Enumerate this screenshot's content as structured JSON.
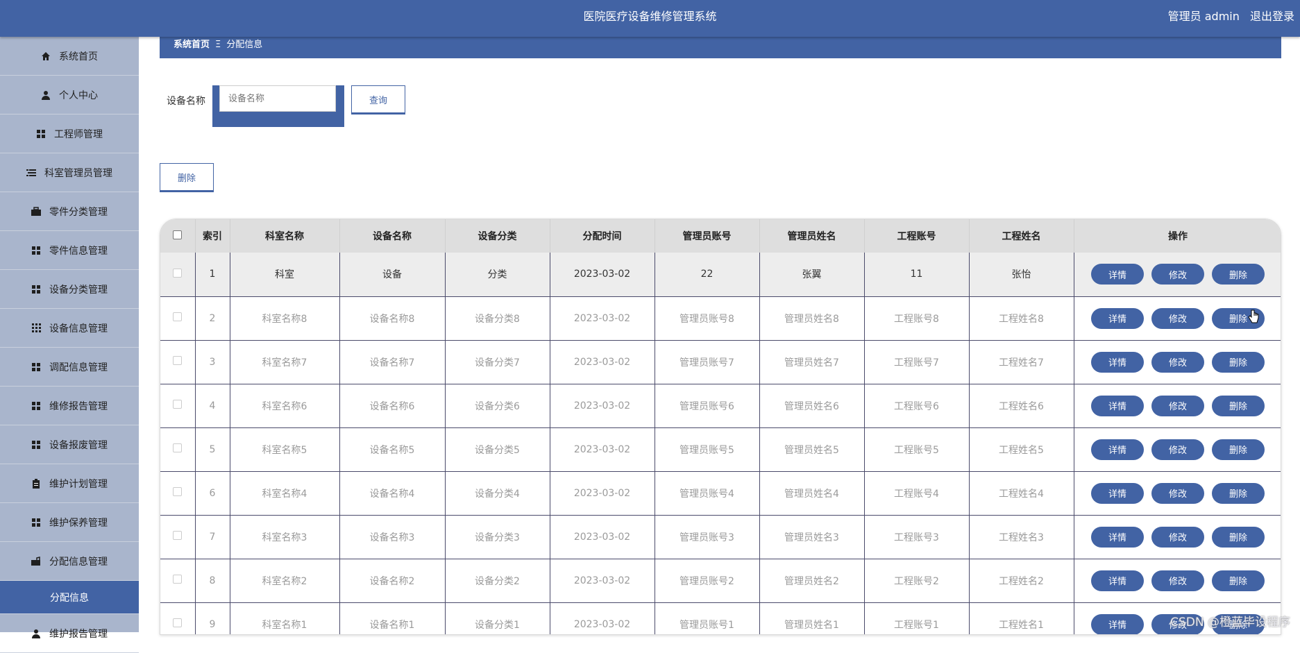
{
  "app": {
    "title": "医院医疗设备维修管理系统",
    "user": "管理员 admin",
    "logout": "退出登录"
  },
  "sidebar": {
    "items": [
      {
        "label": "系统首页",
        "icon": "home-icon"
      },
      {
        "label": "个人中心",
        "icon": "user-icon"
      },
      {
        "label": "工程师管理",
        "icon": "grid-icon"
      },
      {
        "label": "科室管理员管理",
        "icon": "list-icon"
      },
      {
        "label": "零件分类管理",
        "icon": "briefcase-icon"
      },
      {
        "label": "零件信息管理",
        "icon": "grid-icon"
      },
      {
        "label": "设备分类管理",
        "icon": "grid-icon"
      },
      {
        "label": "设备信息管理",
        "icon": "grid9-icon"
      },
      {
        "label": "调配信息管理",
        "icon": "grid-icon"
      },
      {
        "label": "维修报告管理",
        "icon": "grid-icon"
      },
      {
        "label": "设备报废管理",
        "icon": "grid-icon"
      },
      {
        "label": "维护计划管理",
        "icon": "clipboard-icon"
      },
      {
        "label": "维护保养管理",
        "icon": "grid-icon"
      },
      {
        "label": "分配信息管理",
        "icon": "bag-icon"
      }
    ],
    "active": "分配信息",
    "last": {
      "label": "维护报告管理",
      "icon": "user-icon"
    }
  },
  "breadcrumb": {
    "home": "系统首页",
    "sep": "Ξ",
    "current": "分配信息"
  },
  "search": {
    "label": "设备名称",
    "placeholder": "设备名称",
    "query_button": "查询"
  },
  "actions": {
    "delete": "删除"
  },
  "table": {
    "headers": [
      "索引",
      "科室名称",
      "设备名称",
      "设备分类",
      "分配时间",
      "管理员账号",
      "管理员姓名",
      "工程账号",
      "工程姓名",
      "操作"
    ],
    "ops": {
      "detail": "详情",
      "edit": "修改",
      "delete": "删除"
    },
    "rows": [
      [
        "1",
        "科室",
        "设备",
        "分类",
        "2023-03-02",
        "22",
        "张翼",
        "11",
        "张怡"
      ],
      [
        "2",
        "科室名称8",
        "设备名称8",
        "设备分类8",
        "2023-03-02",
        "管理员账号8",
        "管理员姓名8",
        "工程账号8",
        "工程姓名8"
      ],
      [
        "3",
        "科室名称7",
        "设备名称7",
        "设备分类7",
        "2023-03-02",
        "管理员账号7",
        "管理员姓名7",
        "工程账号7",
        "工程姓名7"
      ],
      [
        "4",
        "科室名称6",
        "设备名称6",
        "设备分类6",
        "2023-03-02",
        "管理员账号6",
        "管理员姓名6",
        "工程账号6",
        "工程姓名6"
      ],
      [
        "5",
        "科室名称5",
        "设备名称5",
        "设备分类5",
        "2023-03-02",
        "管理员账号5",
        "管理员姓名5",
        "工程账号5",
        "工程姓名5"
      ],
      [
        "6",
        "科室名称4",
        "设备名称4",
        "设备分类4",
        "2023-03-02",
        "管理员账号4",
        "管理员姓名4",
        "工程账号4",
        "工程姓名4"
      ],
      [
        "7",
        "科室名称3",
        "设备名称3",
        "设备分类3",
        "2023-03-02",
        "管理员账号3",
        "管理员姓名3",
        "工程账号3",
        "工程姓名3"
      ],
      [
        "8",
        "科室名称2",
        "设备名称2",
        "设备分类2",
        "2023-03-02",
        "管理员账号2",
        "管理员姓名2",
        "工程账号2",
        "工程姓名2"
      ],
      [
        "9",
        "科室名称1",
        "设备名称1",
        "设备分类1",
        "2023-03-02",
        "管理员账号1",
        "管理员姓名1",
        "工程账号1",
        "工程姓名1"
      ]
    ]
  },
  "watermark": "CSDN @橙蓝毕设程序",
  "colors": {
    "primary": "#4263a4",
    "sidebar": "#a9b5cc"
  }
}
